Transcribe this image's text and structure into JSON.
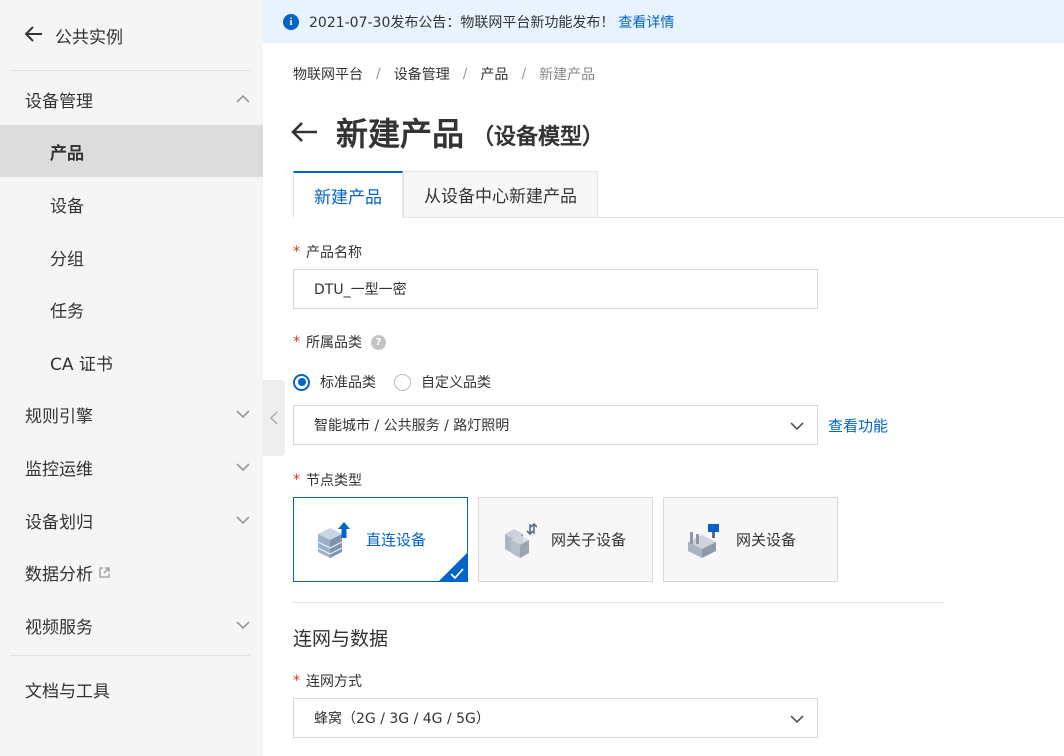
{
  "sidebar": {
    "back_label": "公共实例",
    "items": [
      {
        "label": "设备管理",
        "kind": "top",
        "expanded": true
      },
      {
        "label": "产品",
        "kind": "sub",
        "active": true
      },
      {
        "label": "设备",
        "kind": "sub"
      },
      {
        "label": "分组",
        "kind": "sub"
      },
      {
        "label": "任务",
        "kind": "sub"
      },
      {
        "label": "CA 证书",
        "kind": "sub"
      },
      {
        "label": "规则引擎",
        "kind": "top"
      },
      {
        "label": "监控运维",
        "kind": "top"
      },
      {
        "label": "设备划归",
        "kind": "top"
      },
      {
        "label": "数据分析",
        "kind": "top",
        "external": true
      },
      {
        "label": "视频服务",
        "kind": "top"
      },
      {
        "label": "文档与工具",
        "kind": "top"
      }
    ]
  },
  "announcement": {
    "text": "2021-07-30发布公告：物联网平台新功能发布！",
    "link": "查看详情"
  },
  "breadcrumb": [
    "物联网平台",
    "设备管理",
    "产品",
    "新建产品"
  ],
  "page": {
    "title": "新建产品",
    "subtitle": "（设备模型）"
  },
  "tabs": [
    {
      "label": "新建产品",
      "active": true
    },
    {
      "label": "从设备中心新建产品",
      "active": false
    }
  ],
  "form": {
    "product_name_label": "产品名称",
    "product_name_value": "DTU_一型一密",
    "category_label": "所属品类",
    "radio_standard": "标准品类",
    "radio_custom": "自定义品类",
    "category_value": "智能城市 / 公共服务 / 路灯照明",
    "view_function_link": "查看功能",
    "node_type_label": "节点类型",
    "node_types": [
      {
        "label": "直连设备",
        "selected": true
      },
      {
        "label": "网关子设备",
        "selected": false
      },
      {
        "label": "网关设备",
        "selected": false
      }
    ],
    "section_title": "连网与数据",
    "network_label": "连网方式",
    "network_value": "蜂窝（2G / 3G / 4G / 5G）"
  },
  "colors": {
    "accent": "#0064c8",
    "required": "#d93026",
    "sidebar_bg": "#f5f5f6",
    "announce_bg": "#e8f3ff"
  }
}
